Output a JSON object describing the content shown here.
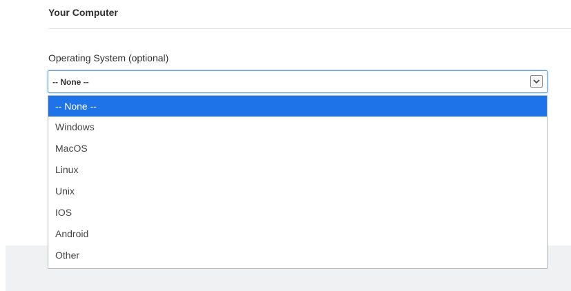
{
  "section": {
    "title": "Your Computer"
  },
  "field": {
    "label": "Operating System (optional)",
    "selected_value": "-- None --"
  },
  "dropdown": {
    "options": [
      "-- None --",
      "Windows",
      "MacOS",
      "Linux",
      "Unix",
      "IOS",
      "Android",
      "Other"
    ],
    "highlighted_index": 0
  },
  "icons": {
    "select_arrow": "chevron-down-icon"
  },
  "colors": {
    "highlight": "#1e73e8",
    "focus_border": "#5e9ed6"
  }
}
